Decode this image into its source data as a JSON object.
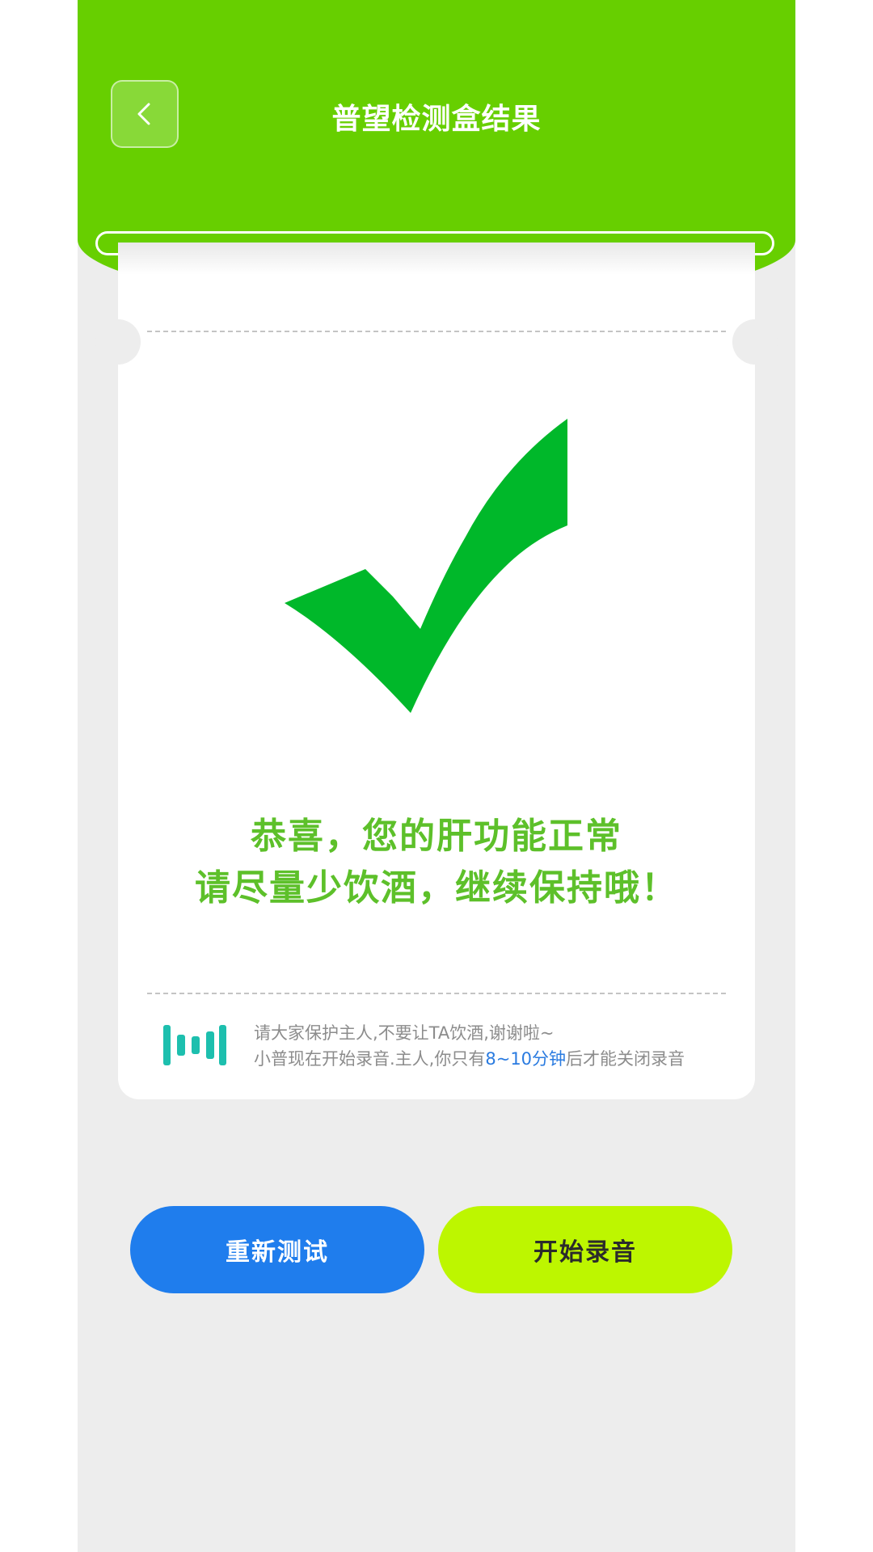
{
  "header": {
    "title": "普望检测盒结果",
    "back_icon": "chevron-left-icon",
    "color": "#67cf00"
  },
  "result": {
    "icon": "checkmark-icon",
    "icon_color": "#00b82a",
    "line1": "恭喜，您的肝功能正常",
    "line2": "请尽量少饮酒，继续保持哦！",
    "text_color": "#5dc02a"
  },
  "notice": {
    "icon": "sound-wave-icon",
    "line1": "请大家保护主人,不要让TA饮酒,谢谢啦~",
    "line2_before": "小普现在开始录音.主人,你只有",
    "line2_highlight": "8~10分钟",
    "line2_after": "后才能关闭录音"
  },
  "buttons": {
    "retest_label": "重新测试",
    "retest_color": "#1f7ded",
    "record_label": "开始录音",
    "record_color": "#bdf600"
  }
}
